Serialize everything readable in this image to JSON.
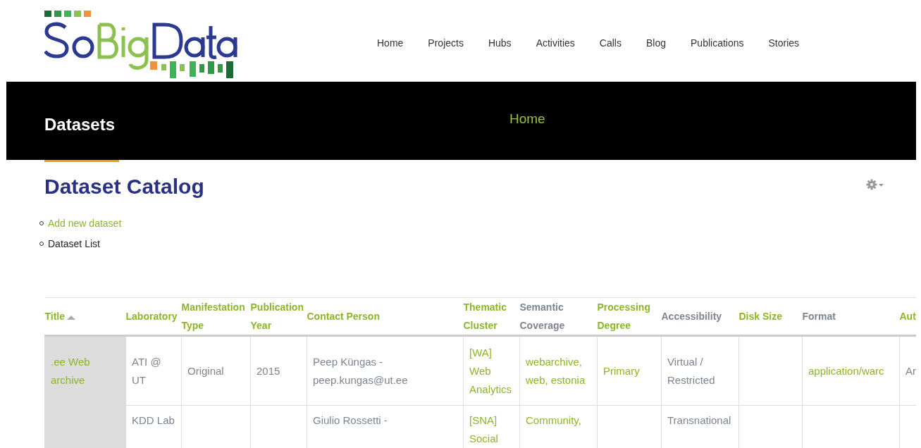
{
  "site": {
    "nav": [
      "Home",
      "Projects",
      "Hubs",
      "Activities",
      "Calls",
      "Blog",
      "Publications",
      "Stories"
    ]
  },
  "banner": {
    "title": "Datasets",
    "breadcrumb": "Home"
  },
  "page": {
    "heading": "Dataset Catalog",
    "links": [
      {
        "label": "Add new dataset",
        "kind": "link"
      },
      {
        "label": "Dataset List",
        "kind": "text"
      }
    ]
  },
  "table": {
    "columns": [
      {
        "lines": [
          "Title"
        ],
        "kind": "link",
        "sorted": true
      },
      {
        "lines": [
          "Laboratory"
        ],
        "kind": "link",
        "sorted": false
      },
      {
        "lines": [
          "Manifestation",
          "Type"
        ],
        "kind": "link",
        "sorted": false
      },
      {
        "lines": [
          "Publication",
          "Year"
        ],
        "kind": "link",
        "sorted": false
      },
      {
        "lines": [
          "Contact Person"
        ],
        "kind": "link",
        "sorted": false
      },
      {
        "lines": [
          "Thematic",
          "Cluster"
        ],
        "kind": "link",
        "sorted": false
      },
      {
        "lines": [
          "Semantic",
          "Coverage"
        ],
        "kind": "text",
        "sorted": false
      },
      {
        "lines": [
          "Processing",
          "Degree"
        ],
        "kind": "link",
        "sorted": false
      },
      {
        "lines": [
          "Accessibility"
        ],
        "kind": "text",
        "sorted": false
      },
      {
        "lines": [
          "Disk Size"
        ],
        "kind": "link",
        "sorted": false
      },
      {
        "lines": [
          "Format"
        ],
        "kind": "text",
        "sorted": false
      },
      {
        "lines": [
          "Aut"
        ],
        "kind": "link",
        "sorted": false
      }
    ],
    "rows": [
      [
        {
          "lines": [
            ".ee Web",
            "archive"
          ],
          "kind": "link"
        },
        {
          "lines": [
            "ATI @",
            "UT"
          ],
          "kind": "text"
        },
        {
          "lines": [
            "Original"
          ],
          "kind": "text"
        },
        {
          "lines": [
            "2015"
          ],
          "kind": "text"
        },
        {
          "lines": [
            "Peep Küngas -",
            "peep.kungas@ut.ee"
          ],
          "kind": "text"
        },
        {
          "lines": [
            "[WA]",
            "Web",
            "Analytics"
          ],
          "kind": "link"
        },
        {
          "lines": [
            "webarchive,",
            "web, estonia"
          ],
          "kind": "link"
        },
        {
          "lines": [
            "Primary"
          ],
          "kind": "link"
        },
        {
          "lines": [
            "Virtual /",
            "Restricted"
          ],
          "kind": "text"
        },
        null,
        {
          "lines": [
            "application/warc"
          ],
          "kind": "link"
        },
        {
          "lines": [
            "Ar"
          ],
          "kind": "text"
        }
      ],
      [
        null,
        {
          "lines": [
            "KDD Lab"
          ],
          "kind": "text"
        },
        null,
        null,
        {
          "lines": [
            "Giulio Rossetti -"
          ],
          "kind": "text"
        },
        {
          "lines": [
            "[SNA]",
            "Social"
          ],
          "kind": "link"
        },
        {
          "lines": [
            "Community,"
          ],
          "kind": "link"
        },
        null,
        {
          "lines": [
            "Transnational"
          ],
          "kind": "text"
        },
        null,
        null,
        null
      ]
    ]
  }
}
